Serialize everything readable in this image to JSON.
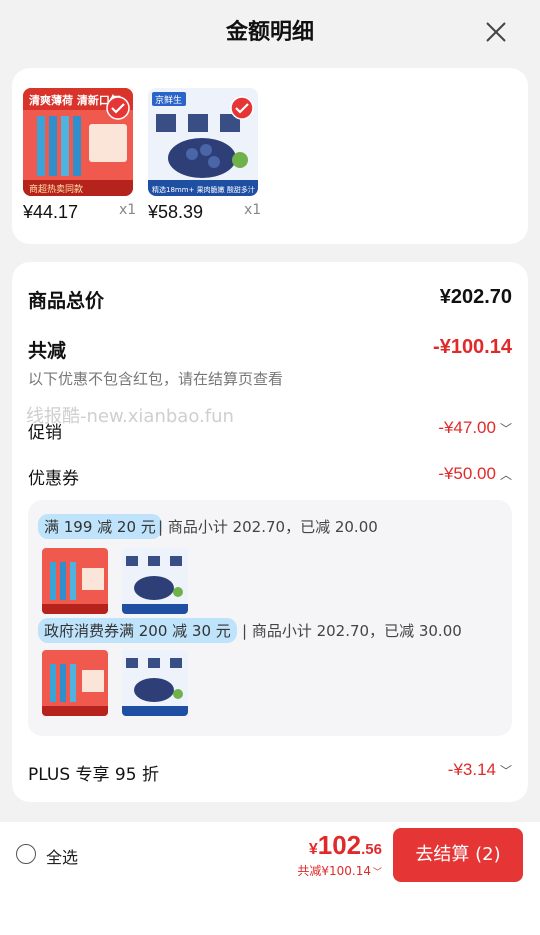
{
  "header": {
    "title": "金额明细"
  },
  "products": [
    {
      "price": "¥44.17",
      "qty": "x1",
      "banner_text": "清爽薄荷 清新口气",
      "promo_text": "商超热卖同款"
    },
    {
      "price": "¥58.39",
      "qty": "x1",
      "brand_text": "京鲜生",
      "caption_text": "精选18mm+ 果肉脆嫩 酸甜多汁"
    }
  ],
  "summary": {
    "total_label": "商品总价",
    "total_value": "¥202.70",
    "discount_label": "共减",
    "discount_value": "-¥100.14",
    "discount_note": "以下优惠不包含红包，请在结算页查看",
    "promo_label": "促销",
    "promo_value": "-¥47.00",
    "coupon_label": "优惠券",
    "coupon_value": "-¥50.00",
    "coupons": [
      {
        "tag": "满 199 减 20 元",
        "note": "| 商品小计 202.70，已减 20.00"
      },
      {
        "tag": "政府消费券满 200 减 30 元",
        "note": "| 商品小计 202.70，已减 30.00"
      }
    ],
    "plus_label": "PLUS 专享 95 折",
    "plus_value": "-¥3.14"
  },
  "watermark": "线报酷-new.xianbao.fun",
  "footer": {
    "select_all": "全选",
    "currency": "¥",
    "price_int": "102",
    "price_dec": ".56",
    "saved": "共减¥100.14",
    "checkout": "去结算 (2)"
  },
  "colors": {
    "accent": "#e53535",
    "discount": "#e02a2a",
    "tag_bg": "#bfe3fb"
  }
}
